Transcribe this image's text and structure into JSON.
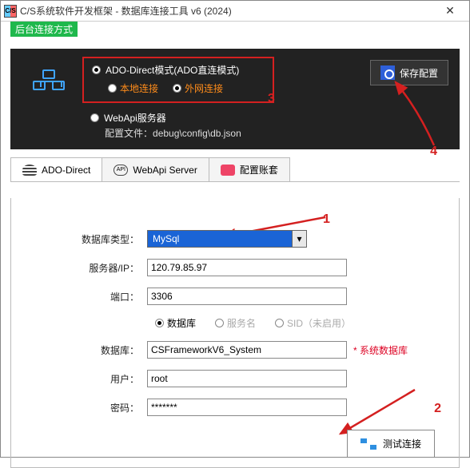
{
  "window": {
    "title": "C/S系统软件开发框架 - 数据库连接工具 v6 (2024)",
    "icon_text": "C/S"
  },
  "top_panel": {
    "tag": "后台连接方式",
    "mode": {
      "ado_label": "ADO-Direct模式(ADO直连模式)",
      "local_label": "本地连接",
      "external_label": "外网连接"
    },
    "webapi": {
      "label": "WebApi服务器",
      "config_prefix": "配置文件：",
      "config_path": "debug\\config\\db.json"
    },
    "save_button": "保存配置"
  },
  "annotations": {
    "n1": "1",
    "n2": "2",
    "n3": "3",
    "n4": "4"
  },
  "tabs": {
    "ado": "ADO-Direct",
    "webapi": "WebApi Server",
    "account": "配置账套",
    "api_text": "API"
  },
  "form": {
    "db_type_label": "数据库类型：",
    "db_type_value": "MySql",
    "server_label": "服务器/IP：",
    "server_value": "120.79.85.97",
    "port_label": "端口：",
    "port_value": "3306",
    "mode_db": "数据库",
    "mode_svc": "服务名",
    "mode_sid": "SID（未启用）",
    "db_label": "数据库：",
    "db_value": "CSFrameworkV6_System",
    "db_note": "* 系统数据库",
    "user_label": "用户：",
    "user_value": "root",
    "pwd_label": "密码：",
    "pwd_value": "*******",
    "test_button": "测试连接"
  }
}
